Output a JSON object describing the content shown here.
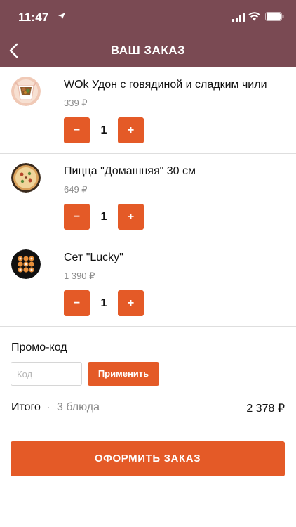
{
  "status_bar": {
    "time": "11:47"
  },
  "header": {
    "title": "ВАШ ЗАКАЗ"
  },
  "items": [
    {
      "name": "WOk Удон с говядиной и сладким чили",
      "price": "339 ₽",
      "quantity": "1",
      "minus": "−",
      "plus": "+"
    },
    {
      "name": "Пицца \"Домашняя\" 30 см",
      "price": "649 ₽",
      "quantity": "1",
      "minus": "−",
      "plus": "+"
    },
    {
      "name": "Сет \"Lucky\"",
      "price": "1 390 ₽",
      "quantity": "1",
      "minus": "−",
      "plus": "+"
    }
  ],
  "promo": {
    "label": "Промо-код",
    "placeholder": "Код",
    "apply_label": "Применить"
  },
  "total": {
    "label": "Итого",
    "separator": "·",
    "count": "3 блюда",
    "sum": "2 378 ₽"
  },
  "checkout": {
    "label": "ОФОРМИТЬ ЗАКАЗ"
  },
  "colors": {
    "header": "#7a4a53",
    "accent": "#e45a27"
  },
  "icons": [
    "location-arrow-icon",
    "signal-icon",
    "wifi-icon",
    "battery-icon",
    "back-chevron-icon"
  ]
}
